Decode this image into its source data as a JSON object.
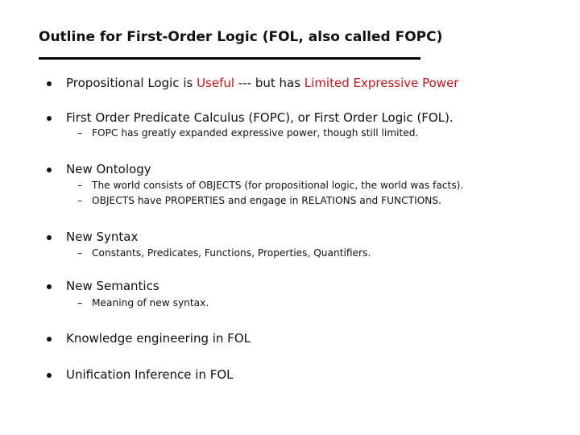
{
  "slide": {
    "title": "Outline for First-Order Logic (FOL, also called FOPC)",
    "bullets": [
      {
        "parts": [
          {
            "text": "Propositional Logic is ",
            "emphasis": false
          },
          {
            "text": "Useful",
            "emphasis": true
          },
          {
            "text": " --- but has ",
            "emphasis": false
          },
          {
            "text": "Limited Expressive Power",
            "emphasis": true
          }
        ],
        "subs": []
      },
      {
        "text": "First Order Predicate Calculus (FOPC), or First Order Logic (FOL).",
        "subs": [
          "FOPC has greatly expanded expressive power, though still limited."
        ]
      },
      {
        "text": "New Ontology",
        "subs": [
          "The world consists of OBJECTS (for propositional logic, the world was facts).",
          "OBJECTS have PROPERTIES and engage in RELATIONS and FUNCTIONS."
        ]
      },
      {
        "text": "New Syntax",
        "subs": [
          "Constants, Predicates, Functions, Properties, Quantifiers."
        ]
      },
      {
        "text": "New Semantics",
        "subs": [
          "Meaning of new syntax."
        ]
      },
      {
        "text": "Knowledge engineering in FOL",
        "subs": []
      },
      {
        "text": "Unification Inference in FOL",
        "subs": []
      }
    ],
    "dash_glyph": "–",
    "emphasis_color": "#c0151b"
  }
}
